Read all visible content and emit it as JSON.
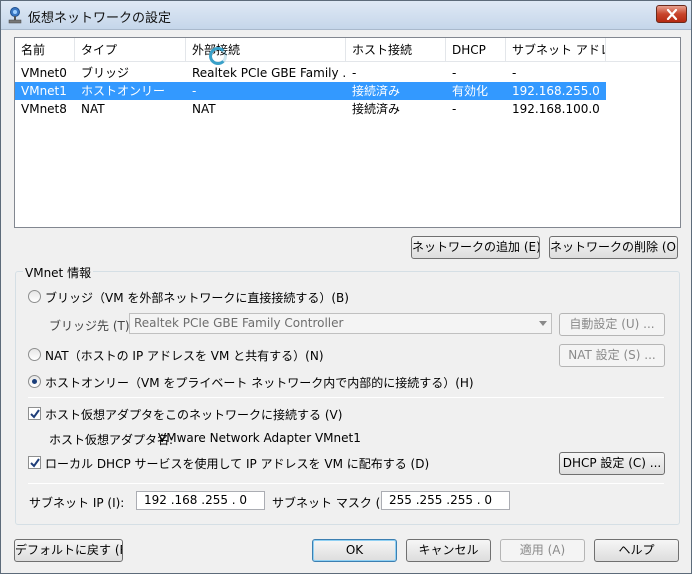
{
  "window": {
    "title": "仮想ネットワークの設定"
  },
  "list": {
    "columns": [
      "名前",
      "タイプ",
      "外部接続",
      "ホスト接続",
      "DHCP",
      "サブネット アドレス"
    ],
    "rows": [
      [
        "VMnet0",
        "ブリッジ",
        "Realtek PCIe GBE Family ...",
        "-",
        "-",
        "-"
      ],
      [
        "VMnet1",
        "ホストオンリー",
        "-",
        "接続済み",
        "有効化",
        "192.168.255.0"
      ],
      [
        "VMnet8",
        "NAT",
        "NAT",
        "接続済み",
        "-",
        "192.168.100.0"
      ]
    ],
    "selected_row": 1
  },
  "buttons": {
    "add_network": "ネットワークの追加 (E)...",
    "remove_network": "ネットワークの削除 (O)",
    "auto_settings": "自動設定 (U) ...",
    "nat_settings": "NAT 設定 (S) ...",
    "dhcp_settings": "DHCP 設定 (C) ...",
    "restore_defaults": "デフォルトに戻す (R)",
    "ok": "OK",
    "cancel": "キャンセル",
    "apply": "適用 (A)",
    "help": "ヘルプ"
  },
  "vmnet_info": {
    "group_label": "VMnet 情報",
    "bridge_radio": "ブリッジ（VM を外部ネットワークに直接接続する）(B)",
    "bridge_to_label": "ブリッジ先 (T):",
    "bridge_to_value": "Realtek PCIe GBE Family Controller",
    "nat_radio": "NAT（ホストの IP アドレスを VM と共有する）(N)",
    "host_only_radio": "ホストオンリー（VM をプライベート ネットワーク内で内部的に接続する）(H)",
    "selected_mode": "host_only",
    "connect_adapter_check": "ホスト仮想アダプタをこのネットワークに接続する (V)",
    "connect_adapter_checked": true,
    "adapter_name_label": "ホスト仮想アダプタ名:",
    "adapter_name_value": "VMware Network Adapter VMnet1",
    "dhcp_check": "ローカル DHCP サービスを使用して IP アドレスを VM に配布する (D)",
    "dhcp_checked": true,
    "subnet_ip_label": "サブネット IP (I):",
    "subnet_ip_value": "192 .168 .255 .  0",
    "subnet_mask_label": "サブネット マスク (M):",
    "subnet_mask_value": "255 .255 .255 .  0"
  },
  "colors": {
    "selection": "#3399ff",
    "close_button": "#c8452c"
  },
  "icons": {
    "app": "network-icon",
    "close": "close-icon",
    "dropdown": "chevron-down-icon",
    "check": "checkmark-icon"
  }
}
